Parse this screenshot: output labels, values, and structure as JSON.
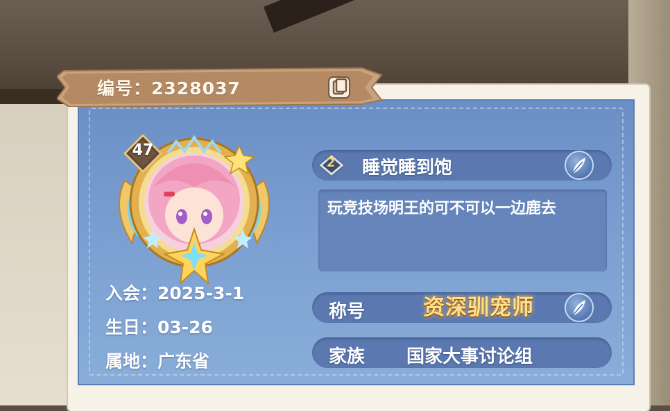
{
  "header": {
    "id_label": "编号：2328037"
  },
  "avatar": {
    "level": "47"
  },
  "profile": {
    "join_date": "入会：2025-3-1",
    "birthday": "生日：03-26",
    "location": "属地：广东省"
  },
  "player": {
    "rank": "2",
    "name": "睡觉睡到饱",
    "signature": "玩竞技场明王的可不可以一边鹿去"
  },
  "title_row": {
    "label": "称号",
    "value": "资深驯宠师"
  },
  "clan_row": {
    "label": "家族",
    "value": "国家大事讨论组"
  },
  "colors": {
    "panel": "#7a9ed0",
    "ribbon": "#c9a27e",
    "pill": "#5b79b0",
    "title_gold": "#ffe08a"
  },
  "icons": {
    "copy": "copy-icon",
    "edit_name": "feather-icon",
    "edit_title": "feather-icon",
    "level": "diamond-badge-icon",
    "rank": "rank-badge-icon"
  }
}
